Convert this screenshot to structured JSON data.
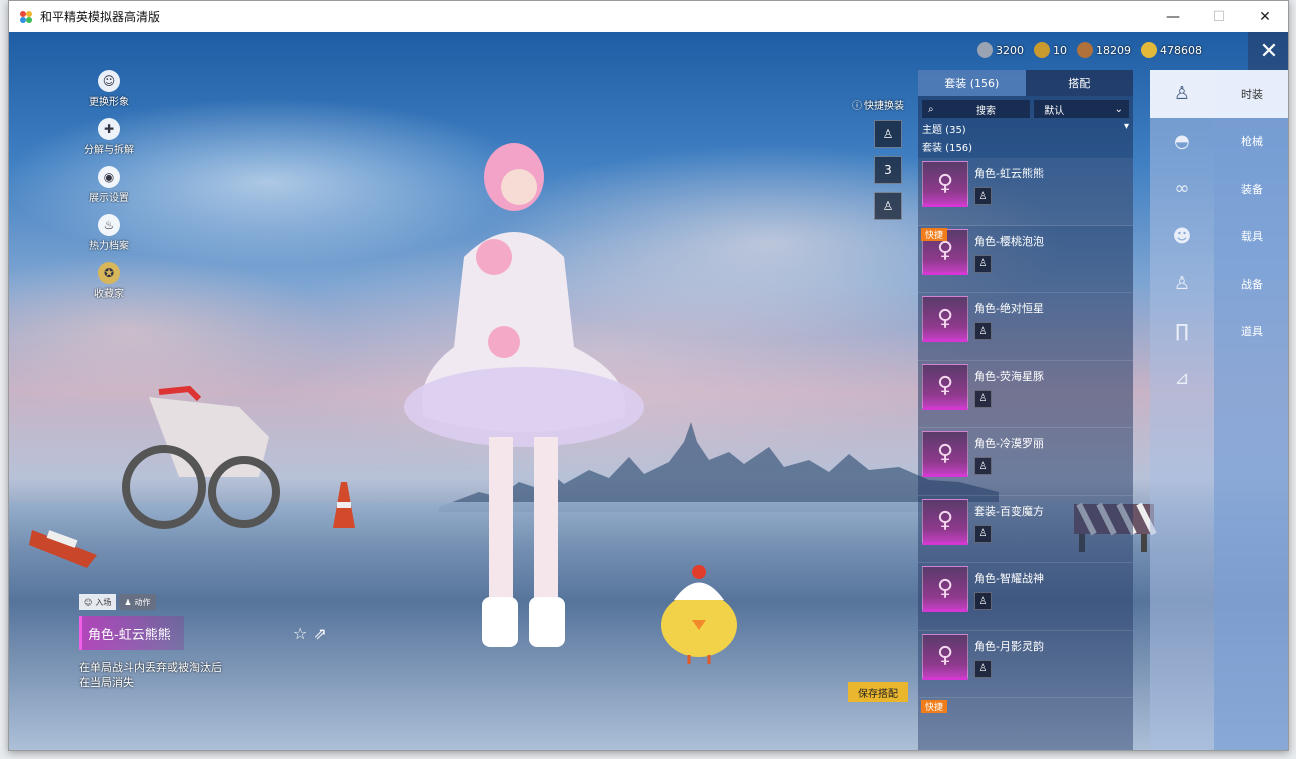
{
  "window": {
    "title": "和平精英模拟器高清版",
    "controls": {
      "minimize": "—",
      "maximize": "☐",
      "close": "✕"
    }
  },
  "currency": [
    {
      "icon": "silver-coin-icon",
      "value": "3200",
      "color": "#9aa3b2"
    },
    {
      "icon": "gold-badge-icon",
      "value": "10",
      "color": "#c99a2e"
    },
    {
      "icon": "bronze-coin-icon",
      "value": "18209",
      "color": "#b0713a"
    },
    {
      "icon": "gold-coin-icon",
      "value": "478608",
      "color": "#e3b93a"
    }
  ],
  "left_menu": [
    {
      "icon": "avatar-icon",
      "label": "更换形象"
    },
    {
      "icon": "puzzle-icon",
      "label": "分解与拆解"
    },
    {
      "icon": "eye-icon",
      "label": "展示设置"
    },
    {
      "icon": "flame-icon",
      "label": "热力档案"
    },
    {
      "icon": "medal-icon",
      "label": "收藏家"
    }
  ],
  "quick_swap": {
    "label": "快捷换装",
    "slot2": "3"
  },
  "panel": {
    "tabs": [
      "套装 (156)",
      "搭配"
    ],
    "search": {
      "placeholder": "搜索"
    },
    "sort": "默认",
    "theme": "主题 (35)",
    "suits": "套装 (156)",
    "items": [
      {
        "name": "角色-虹云熊熊",
        "badge": ""
      },
      {
        "name": "角色-樱桃泡泡",
        "badge": "快捷"
      },
      {
        "name": "角色-绝对恒星",
        "badge": ""
      },
      {
        "name": "角色-荧海星豚",
        "badge": ""
      },
      {
        "name": "角色-冷漠罗丽",
        "badge": ""
      },
      {
        "name": "套装-百变魔方",
        "badge": ""
      },
      {
        "name": "角色-智耀战神",
        "badge": ""
      },
      {
        "name": "角色-月影灵韵",
        "badge": ""
      }
    ],
    "last_badge": "快捷"
  },
  "save_button": "保存搭配",
  "categories": [
    "outfit-icon",
    "cap-icon",
    "goggles-icon",
    "face-icon",
    "body-icon",
    "pants-icon",
    "shoes-icon"
  ],
  "side_tabs": [
    "时装",
    "枪械",
    "装备",
    "载具",
    "战备",
    "道具"
  ],
  "character": {
    "chips": [
      "入场",
      "动作"
    ],
    "name": "角色-虹云熊熊",
    "description": "在单局战斗内丢弃或被淘汰后在当局消失"
  }
}
